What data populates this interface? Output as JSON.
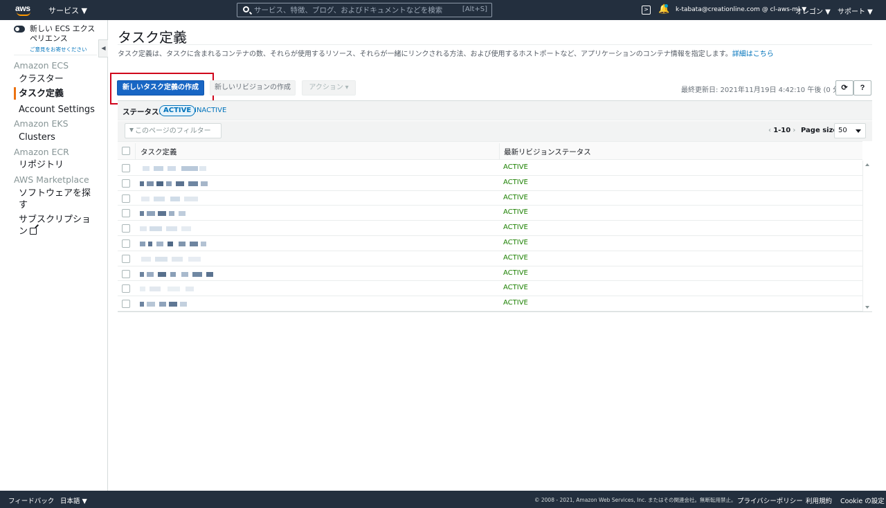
{
  "topnav": {
    "logo": "aws",
    "services": "サービス ▼",
    "search_placeholder": "サービス、特徴、ブログ、およびドキュメントなどを検索",
    "search_shortcut": "[Alt+S]",
    "account": "k-tabata@creationline.com @ cl-aws-ml ▼",
    "region": "オレゴン ▼",
    "support": "サポート ▼"
  },
  "sidebar": {
    "new_experience": "新しい ECS エクスペリエンス",
    "feedback": "ご意見をお寄せください",
    "sections": [
      {
        "heading": "Amazon ECS",
        "items": [
          "クラスター",
          "タスク定義",
          "Account Settings"
        ]
      },
      {
        "heading": "Amazon EKS",
        "items": [
          "Clusters"
        ]
      },
      {
        "heading": "Amazon ECR",
        "items": [
          "リポジトリ"
        ]
      },
      {
        "heading": "AWS Marketplace",
        "items": [
          "ソフトウェアを探す",
          "サブスクリプション"
        ]
      }
    ]
  },
  "main": {
    "title": "タスク定義",
    "description": "タスク定義は、タスクに含まれるコンテナの数、それらが使用するリソース、それらが一緒にリンクされる方法、および使用するホストポートなど、アプリケーションのコンテナ情報を指定します。",
    "details_link": "詳細はこちら",
    "create_button": "新しいタスク定義の作成",
    "revision_button": "新しいリビジョンの作成",
    "actions_button": "アクション ▾",
    "last_updated": "最終更新日: 2021年11月19日 4:42:10 午後 (0 分前)",
    "status_label": "ステータス:",
    "status_active": "ACTIVE",
    "status_inactive": "INACTIVE",
    "filter_placeholder": "このページのフィルター",
    "pager_range": "1-10",
    "page_size_label": "Page size",
    "page_size": "50",
    "columns": [
      "タスク定義",
      "最新リビジョンステータス"
    ],
    "rows": [
      {
        "status": "ACTIVE"
      },
      {
        "status": "ACTIVE"
      },
      {
        "status": "ACTIVE"
      },
      {
        "status": "ACTIVE"
      },
      {
        "status": "ACTIVE"
      },
      {
        "status": "ACTIVE"
      },
      {
        "status": "ACTIVE"
      },
      {
        "status": "ACTIVE"
      },
      {
        "status": "ACTIVE"
      },
      {
        "status": "ACTIVE"
      }
    ]
  },
  "footer": {
    "feedback": "フィードバック",
    "language": "日本語 ▼",
    "copyright": "© 2008 - 2021, Amazon Web Services, Inc. またはその関連会社。無断転用禁止。",
    "privacy": "プライバシーポリシー",
    "terms": "利用規約",
    "cookie": "Cookie の設定"
  },
  "colors": {
    "nav_bg": "#232f3e",
    "primary": "#1866c4",
    "active_text": "#1d8102",
    "link": "#0073bb",
    "accent": "#ec7211",
    "highlight": "#d0021b"
  }
}
